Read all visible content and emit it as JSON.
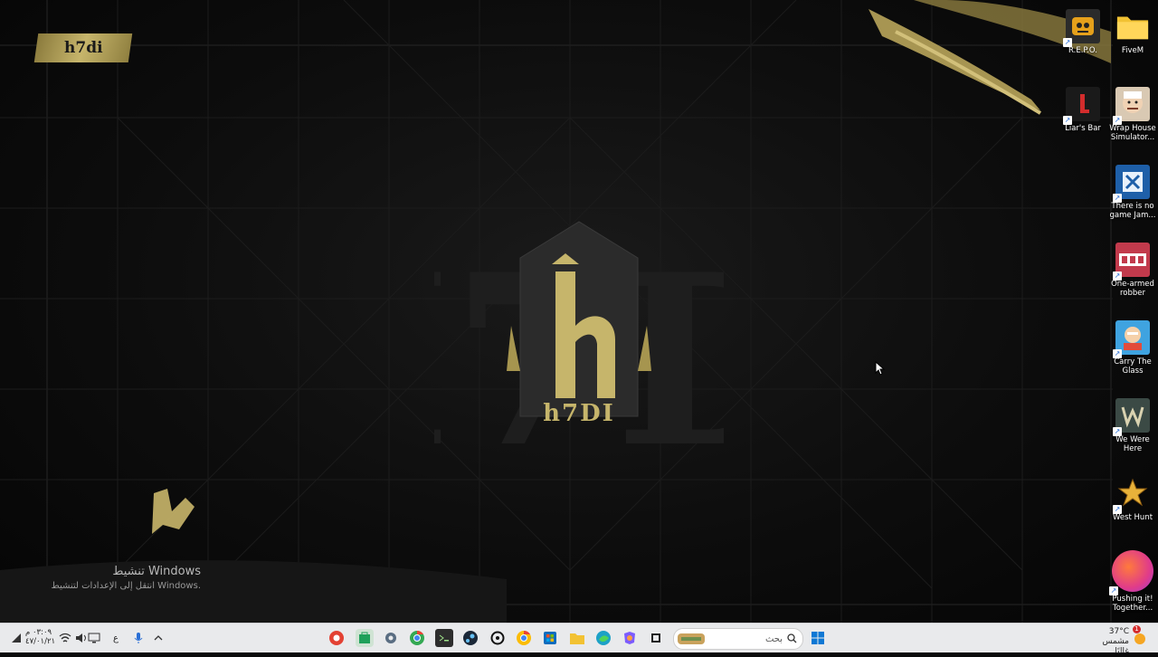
{
  "wallpaper": {
    "brand_tag": "h7di",
    "logo_text": "h7DI",
    "activation_title": "تنشيط Windows",
    "activation_subtitle": "انتقل إلى الإعدادات لتنشيط Windows."
  },
  "desktop_icons": [
    {
      "label": "R.E.P.O.",
      "icon": "repo-icon"
    },
    {
      "label": "FiveM",
      "icon": "folder-icon"
    },
    {
      "label": "Liar's Bar",
      "icon": "liars-bar-icon"
    },
    {
      "label": "Wrap House Simulator...",
      "icon": "wrap-house-icon"
    },
    {
      "label": "There is no game Jam...",
      "icon": "no-game-icon"
    },
    {
      "label": "One-armed robber",
      "icon": "one-armed-robber-icon"
    },
    {
      "label": "Carry The Glass",
      "icon": "carry-the-glass-icon"
    },
    {
      "label": "We Were Here",
      "icon": "we-were-here-icon"
    },
    {
      "label": "West Hunt",
      "icon": "west-hunt-icon"
    },
    {
      "label": "Pushing it! Together...",
      "icon": "pushing-it-icon"
    }
  ],
  "taskbar": {
    "clock_time": "٠٣:٠٩ م",
    "clock_date": "٤٧/٠١/٢١",
    "language": "ع",
    "search_placeholder": "بحث",
    "weather_temp": "37°C",
    "weather_desc": "مشمس غالبًا",
    "weather_badge": "1"
  }
}
